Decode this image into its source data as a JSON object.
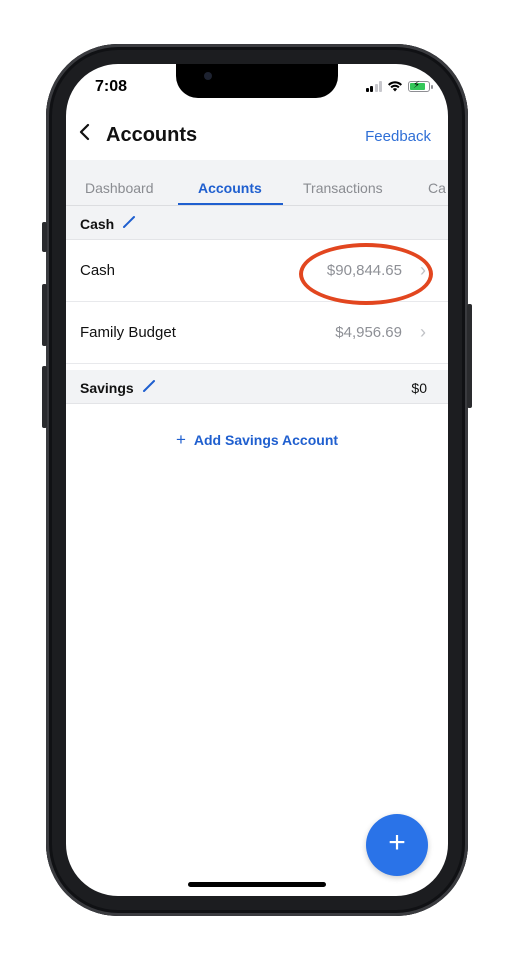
{
  "status": {
    "time": "7:08"
  },
  "nav": {
    "title": "Accounts",
    "feedback": "Feedback"
  },
  "tabs": [
    {
      "label": "Dashboard"
    },
    {
      "label": "Accounts",
      "active": true
    },
    {
      "label": "Transactions"
    },
    {
      "label": "Ca"
    }
  ],
  "sections": {
    "cash": {
      "title": "Cash",
      "rows": [
        {
          "label": "Cash",
          "amount": "$90,844.65"
        },
        {
          "label": "Family Budget",
          "amount": "$4,956.69"
        }
      ]
    },
    "savings": {
      "title": "Savings",
      "total": "$0",
      "add_label": "Add Savings Account"
    }
  },
  "colors": {
    "accent": "#1f5fcf",
    "fab": "#2a73e8",
    "highlight": "#e2461f"
  },
  "icons": {
    "back": "chevron-left-icon",
    "edit": "pencil-icon",
    "row_chevron": "chevron-right-icon",
    "fab": "plus-icon"
  }
}
